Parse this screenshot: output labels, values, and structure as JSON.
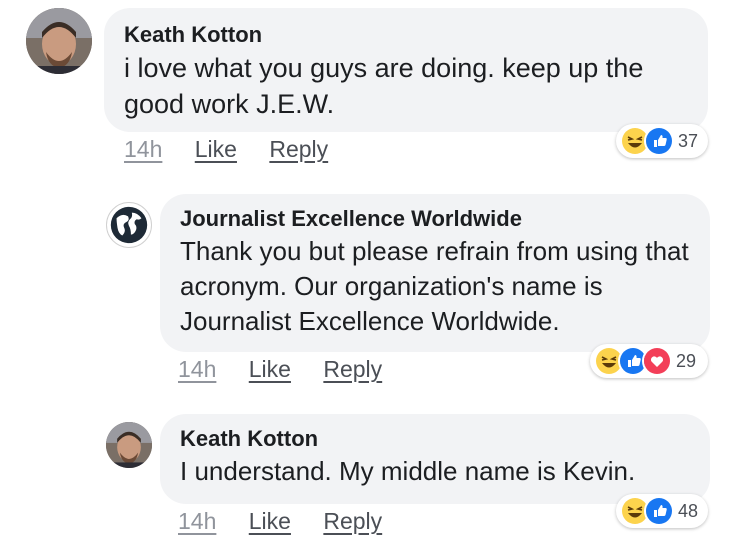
{
  "comments": [
    {
      "author": "Keath Kotton",
      "text": "i love what you guys are doing.  keep up the good work J.E.W.",
      "timestamp": "14h",
      "like_label": "Like",
      "reply_label": "Reply",
      "reactions": [
        "haha",
        "like"
      ],
      "reaction_count": "37"
    },
    {
      "author": "Journalist Excellence Worldwide",
      "text": "Thank you but please refrain from using that acronym. Our organization's name is Journalist Excellence Worldwide.",
      "timestamp": "14h",
      "like_label": "Like",
      "reply_label": "Reply",
      "reactions": [
        "haha",
        "like",
        "love"
      ],
      "reaction_count": "29"
    },
    {
      "author": "Keath Kotton",
      "text": "I understand.  My middle name is Kevin.",
      "timestamp": "14h",
      "like_label": "Like",
      "reply_label": "Reply",
      "reactions": [
        "haha",
        "like"
      ],
      "reaction_count": "48"
    }
  ],
  "colors": {
    "bubble": "#f2f3f5",
    "like_blue": "#1877f2",
    "love_red": "#f33e58",
    "haha_yellow": "#fcd34d",
    "muted_text": "#90949c"
  }
}
